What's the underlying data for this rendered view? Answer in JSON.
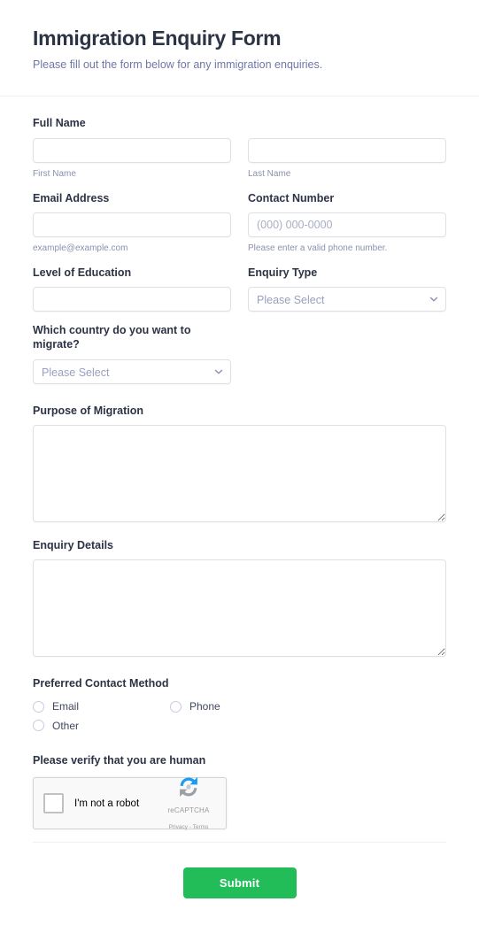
{
  "header": {
    "title": "Immigration Enquiry Form",
    "subtitle": "Please fill out the form below for any immigration enquiries."
  },
  "fields": {
    "full_name": {
      "label": "Full Name",
      "first": {
        "value": "",
        "placeholder": "",
        "sub_label": "First Name"
      },
      "last": {
        "value": "",
        "placeholder": "",
        "sub_label": "Last Name"
      }
    },
    "email": {
      "label": "Email Address",
      "value": "",
      "placeholder": "",
      "sub_label": "example@example.com"
    },
    "contact_number": {
      "label": "Contact Number",
      "value": "",
      "placeholder": "(000) 000-0000",
      "sub_label": "Please enter a valid phone number."
    },
    "education": {
      "label": "Level of Education",
      "value": "",
      "placeholder": ""
    },
    "enquiry_type": {
      "label": "Enquiry Type",
      "selected": "Please Select"
    },
    "country": {
      "label": "Which country do you want to migrate?",
      "selected": "Please Select"
    },
    "purpose": {
      "label": "Purpose of Migration",
      "value": ""
    },
    "enquiry_details": {
      "label": "Enquiry Details",
      "value": ""
    },
    "contact_method": {
      "label": "Preferred Contact Method",
      "options": [
        {
          "label": "Email",
          "selected": false
        },
        {
          "label": "Phone",
          "selected": false
        },
        {
          "label": "Other",
          "selected": false
        }
      ]
    },
    "captcha": {
      "label": "Please verify that you are human",
      "checkbox_text": "I'm not a robot",
      "brand": "reCAPTCHA",
      "links": "Privacy - Terms"
    }
  },
  "footer": {
    "submit_label": "Submit"
  },
  "colors": {
    "submit_green": "#22bd59",
    "title": "#2c3345",
    "subtitle": "#6f76a7",
    "border": "#dfe0e7",
    "placeholder": "#a8adc4"
  }
}
